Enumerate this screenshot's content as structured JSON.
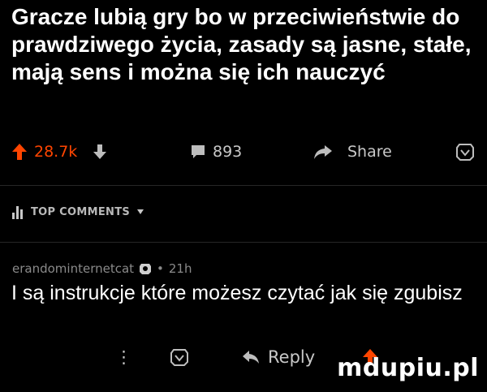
{
  "post": {
    "title": "Gracze lubią gry bo w przeciwieństwie do prawdziwego życia, zasady są jasne, stałe, mają sens i można się ich nauczyć"
  },
  "actions": {
    "upvote_count": "28.7k",
    "comment_count": "893",
    "share_label": "Share",
    "upvote_icon": "arrow-up-icon",
    "downvote_icon": "arrow-down-icon",
    "comment_icon": "comment-icon",
    "share_icon": "share-icon",
    "award_icon": "award-icon"
  },
  "comments_header": {
    "sort_label": "TOP COMMENTS",
    "sort_icon": "bar-chart-icon"
  },
  "comment": {
    "author": "erandominternetcat",
    "time": "21h",
    "separator": "•",
    "text": "I są instrukcje które możesz czytać jak się zgubisz",
    "reply_label": "Reply",
    "more_label": "⋮"
  },
  "watermark": "mdupiu.pl",
  "colors": {
    "background": "#000000",
    "upvote": "#ff4500",
    "text": "#ffffff",
    "muted": "#8a8a8a"
  }
}
